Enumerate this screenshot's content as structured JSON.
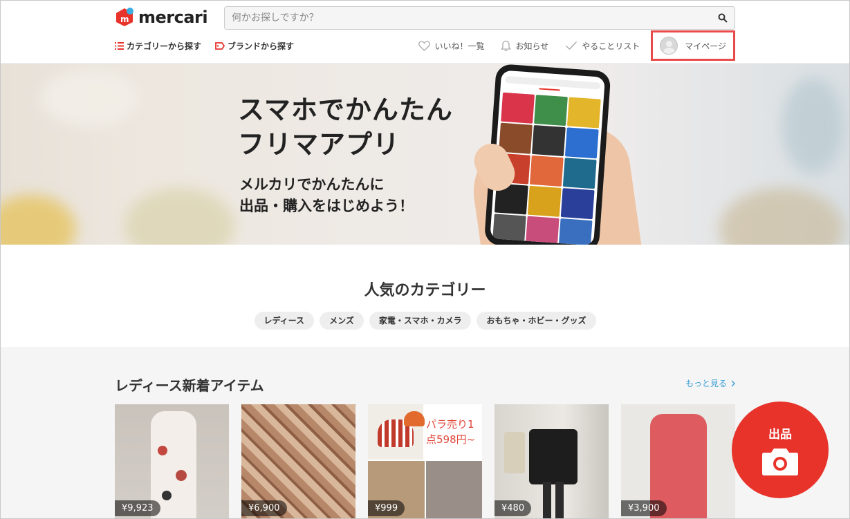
{
  "header": {
    "logo_text": "mercari",
    "logo_mark_letter": "m",
    "search_placeholder": "何かお探しですか？",
    "nav_left": [
      {
        "label": "カテゴリーから探す"
      },
      {
        "label": "ブランドから探す"
      }
    ],
    "nav_right": [
      {
        "label": "いいね！一覧"
      },
      {
        "label": "お知らせ"
      },
      {
        "label": "やることリスト"
      },
      {
        "label": "マイページ"
      }
    ]
  },
  "banner": {
    "headline_line1": "スマホでかんたん",
    "headline_line2": "フリマアプリ",
    "sub_line1": "メルカリでかんたんに",
    "sub_line2": "出品・購入をはじめよう！"
  },
  "popular": {
    "title": "人気のカテゴリー",
    "chips": [
      "レディース",
      "メンズ",
      "家電・スマホ・カメラ",
      "おもちゃ・ホビー・グッズ"
    ]
  },
  "items_section": {
    "title": "レディース新着アイテム",
    "more_label": "もっと見る",
    "items": [
      {
        "price": "¥9,923"
      },
      {
        "price": "¥6,900"
      },
      {
        "price": "¥999",
        "overlay_text_line1": "パラ売り1",
        "overlay_text_line2": "点598円~"
      },
      {
        "price": "¥480"
      },
      {
        "price": "¥3,900"
      }
    ]
  },
  "fab": {
    "label": "出品"
  },
  "colors": {
    "brand": "#e8332b",
    "highlight_border": "#e94b4b",
    "link": "#3a9fd6"
  }
}
